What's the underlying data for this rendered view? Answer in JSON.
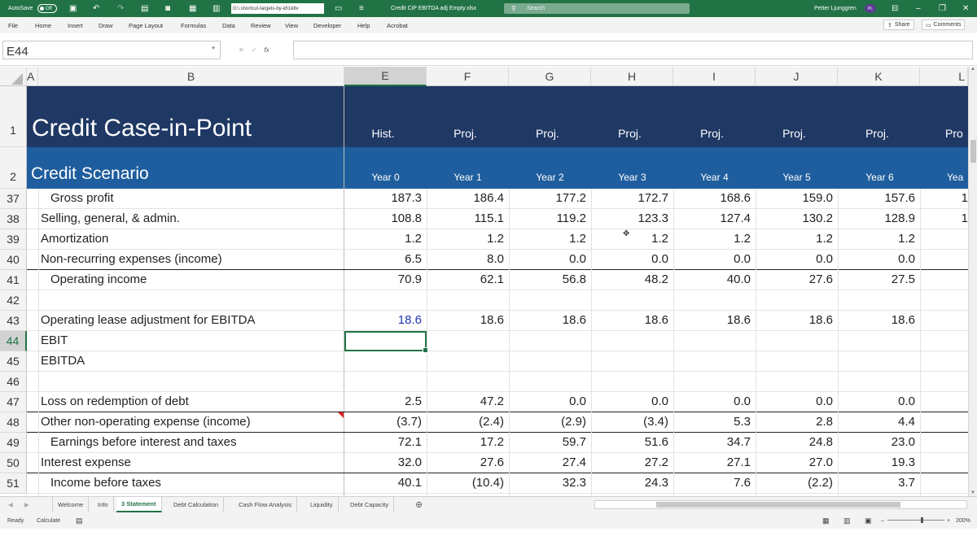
{
  "titlebar": {
    "autosave": "AutoSave",
    "toggle": "Off",
    "path": "G:\\.shortcut-targets-by-id\\1k8v",
    "doc_title": "Credit CiP EBITDA adj Empty.xlsx",
    "search": "Search",
    "user": "Petter Ljunggren",
    "initials": "PL"
  },
  "menu": [
    "File",
    "Home",
    "Insert",
    "Draw",
    "Page Layout",
    "Formulas",
    "Data",
    "Review",
    "View",
    "Developer",
    "Help",
    "Acrobat"
  ],
  "share": "Share",
  "comments": "Comments",
  "namebox": "E44",
  "columns": [
    "A",
    "B",
    "E",
    "F",
    "G",
    "H",
    "I",
    "J",
    "K",
    "L"
  ],
  "rownums": [
    "1",
    "2",
    "37",
    "38",
    "39",
    "40",
    "41",
    "42",
    "43",
    "44",
    "45",
    "46",
    "47",
    "48",
    "49",
    "50",
    "51"
  ],
  "title": "Credit Case-in-Point",
  "subtitle": "Credit Scenario",
  "hdr1": [
    "Hist.",
    "Proj.",
    "Proj.",
    "Proj.",
    "Proj.",
    "Proj.",
    "Proj.",
    "Pro"
  ],
  "hdr2": [
    "Year 0",
    "Year 1",
    "Year 2",
    "Year 3",
    "Year 4",
    "Year 5",
    "Year 6",
    "Yea"
  ],
  "rows": [
    {
      "label": "Gross profit",
      "v": [
        "187.3",
        "186.4",
        "177.2",
        "172.7",
        "168.6",
        "159.0",
        "157.6",
        "1"
      ]
    },
    {
      "label": "Selling, general, & admin.",
      "v": [
        "108.8",
        "115.1",
        "119.2",
        "123.3",
        "127.4",
        "130.2",
        "128.9",
        "1"
      ]
    },
    {
      "label": "Amortization",
      "v": [
        "1.2",
        "1.2",
        "1.2",
        "1.2",
        "1.2",
        "1.2",
        "1.2",
        ""
      ]
    },
    {
      "label": "Non-recurring expenses (income)",
      "v": [
        "6.5",
        "8.0",
        "0.0",
        "0.0",
        "0.0",
        "0.0",
        "0.0",
        ""
      ]
    },
    {
      "label": "Operating income",
      "v": [
        "70.9",
        "62.1",
        "56.8",
        "48.2",
        "40.0",
        "27.6",
        "27.5",
        ""
      ]
    },
    {
      "label": "",
      "v": [
        "",
        "",
        "",
        "",
        "",
        "",
        "",
        ""
      ]
    },
    {
      "label": "Operating lease adjustment for EBITDA",
      "v": [
        "18.6",
        "18.6",
        "18.6",
        "18.6",
        "18.6",
        "18.6",
        "18.6",
        ""
      ]
    },
    {
      "label": "EBIT",
      "v": [
        "",
        "",
        "",
        "",
        "",
        "",
        "",
        ""
      ]
    },
    {
      "label": "EBITDA",
      "v": [
        "",
        "",
        "",
        "",
        "",
        "",
        "",
        ""
      ]
    },
    {
      "label": "",
      "v": [
        "",
        "",
        "",
        "",
        "",
        "",
        "",
        ""
      ]
    },
    {
      "label": "Loss on redemption of debt",
      "v": [
        "2.5",
        "47.2",
        "0.0",
        "0.0",
        "0.0",
        "0.0",
        "0.0",
        ""
      ]
    },
    {
      "label": "Other non-operating expense (income)",
      "v": [
        "(3.7)",
        "(2.4)",
        "(2.9)",
        "(3.4)",
        "5.3",
        "2.8",
        "4.4",
        ""
      ]
    },
    {
      "label": "Earnings before interest and taxes",
      "v": [
        "72.1",
        "17.2",
        "59.7",
        "51.6",
        "34.7",
        "24.8",
        "23.0",
        ""
      ]
    },
    {
      "label": "Interest expense",
      "v": [
        "32.0",
        "27.6",
        "27.4",
        "27.2",
        "27.1",
        "27.0",
        "19.3",
        ""
      ]
    },
    {
      "label": "Income before taxes",
      "v": [
        "40.1",
        "(10.4)",
        "32.3",
        "24.3",
        "7.6",
        "(2.2)",
        "3.7",
        ""
      ]
    }
  ],
  "sheets": [
    "Welcome",
    "Info",
    "3 Statement",
    "Debt Calculation",
    "Cash Flow Analysis",
    "Liquidity",
    "Debt Capacity"
  ],
  "status": {
    "ready": "Ready",
    "calculate": "Calculate",
    "zoom": "200%"
  }
}
